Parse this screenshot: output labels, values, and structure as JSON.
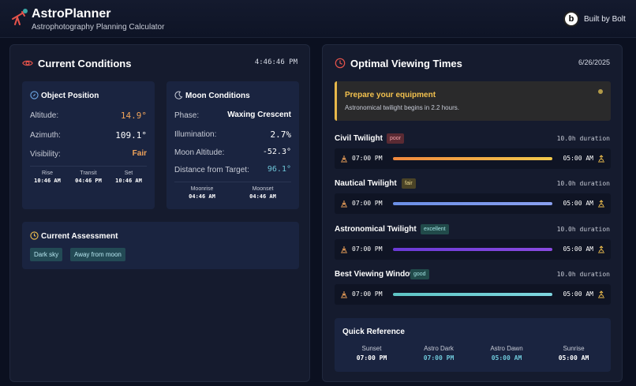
{
  "header": {
    "title": "AstroPlanner",
    "subtitle": "Astrophotography Planning Calculator",
    "badge_letter": "b",
    "badge_text": "Built by Bolt"
  },
  "current": {
    "title": "Current Conditions",
    "time": "4:46:46 PM",
    "object": {
      "title": "Object Position",
      "altitude_label": "Altitude:",
      "altitude_value": "14.9°",
      "azimuth_label": "Azimuth:",
      "azimuth_value": "109.1°",
      "visibility_label": "Visibility:",
      "visibility_value": "Fair",
      "rise_label": "Rise",
      "rise_value": "10:46 AM",
      "transit_label": "Transit",
      "transit_value": "04:46 PM",
      "set_label": "Set",
      "set_value": "10:46 AM"
    },
    "moon": {
      "title": "Moon Conditions",
      "phase_label": "Phase:",
      "phase_value": "Waxing Crescent",
      "illum_label": "Illumination:",
      "illum_value": "2.7%",
      "alt_label": "Moon Altitude:",
      "alt_value": "-52.3°",
      "dist_label": "Distance from Target:",
      "dist_value": "96.1°",
      "moonrise_label": "Moonrise",
      "moonrise_value": "04:46 AM",
      "moonset_label": "Moonset",
      "moonset_value": "04:46 AM"
    },
    "assessment": {
      "title": "Current Assessment",
      "tags": [
        "Dark sky",
        "Away from moon"
      ]
    }
  },
  "optimal": {
    "title": "Optimal Viewing Times",
    "date": "6/26/2025",
    "alert_title": "Prepare your equipment",
    "alert_text": "Astronomical twilight begins in 2.2 hours.",
    "rows": [
      {
        "label": "Civil Twilight",
        "badge": "poor",
        "duration": "10.0h duration",
        "start": "07:00 PM",
        "end": "05:00 AM"
      },
      {
        "label": "Nautical Twilight",
        "badge": "fair",
        "duration": "10.0h duration",
        "start": "07:00 PM",
        "end": "05:00 AM"
      },
      {
        "label": "Astronomical Twilight",
        "badge": "excellent",
        "duration": "10.0h duration",
        "start": "07:00 PM",
        "end": "05:00 AM"
      },
      {
        "label": "Best Viewing Window",
        "badge": "good",
        "duration": "10.0h duration",
        "start": "07:00 PM",
        "end": "05:00 AM"
      }
    ],
    "quickref": {
      "title": "Quick Reference",
      "items": [
        {
          "label": "Sunset",
          "value": "07:00 PM"
        },
        {
          "label": "Astro Dark",
          "value": "07:00 PM"
        },
        {
          "label": "Astro Dawn",
          "value": "05:00 AM"
        },
        {
          "label": "Sunrise",
          "value": "05:00 AM"
        }
      ]
    }
  },
  "colors": {
    "accent_orange": "#f0a35a",
    "accent_teal": "#6ec6d8",
    "warning": "#f2c14e",
    "badge_poor": "#5a2a33",
    "badge_fair": "#4a4326",
    "badge_excellent": "#214a4a",
    "badge_good": "#214a4a"
  }
}
